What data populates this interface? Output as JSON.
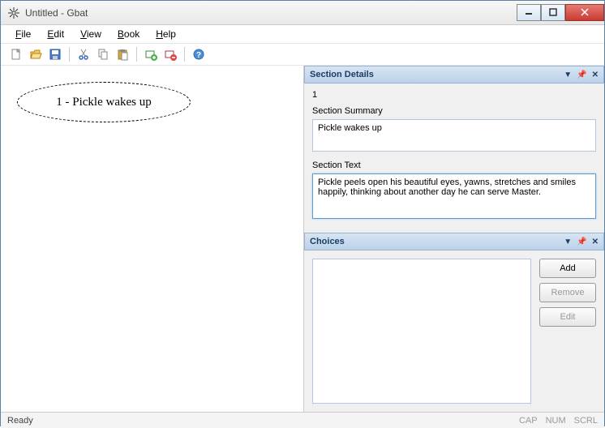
{
  "window": {
    "title": "Untitled - Gbat"
  },
  "menus": {
    "file": "File",
    "edit": "Edit",
    "view": "View",
    "book": "Book",
    "help": "Help"
  },
  "canvas": {
    "node_label": "1 - Pickle wakes up"
  },
  "section_details": {
    "header": "Section Details",
    "number": "1",
    "summary_label": "Section Summary",
    "summary_value": "Pickle wakes up",
    "text_label": "Section Text",
    "text_value": "Pickle peels open his beautiful eyes, yawns, stretches and smiles happily, thinking about another day he can serve Master."
  },
  "choices": {
    "header": "Choices",
    "add_label": "Add",
    "remove_label": "Remove",
    "edit_label": "Edit"
  },
  "statusbar": {
    "ready": "Ready",
    "cap": "CAP",
    "num": "NUM",
    "scrl": "SCRL"
  }
}
